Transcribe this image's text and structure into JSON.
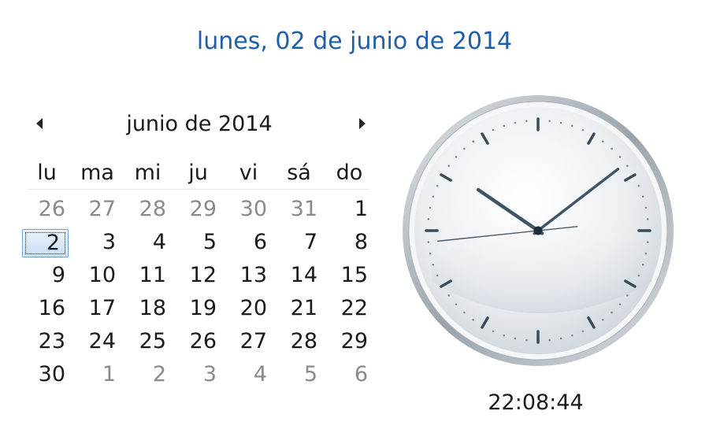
{
  "header": {
    "full_date": "lunes, 02 de junio de 2014"
  },
  "calendar": {
    "month_title": "junio de 2014",
    "prev_icon": "triangle-left-icon",
    "next_icon": "triangle-right-icon",
    "weekdays": [
      "lu",
      "ma",
      "mi",
      "ju",
      "vi",
      "sá",
      "do"
    ],
    "weeks": [
      [
        {
          "d": "26",
          "other": true
        },
        {
          "d": "27",
          "other": true
        },
        {
          "d": "28",
          "other": true
        },
        {
          "d": "29",
          "other": true
        },
        {
          "d": "30",
          "other": true
        },
        {
          "d": "31",
          "other": true
        },
        {
          "d": "1"
        }
      ],
      [
        {
          "d": "2",
          "today": true
        },
        {
          "d": "3"
        },
        {
          "d": "4"
        },
        {
          "d": "5"
        },
        {
          "d": "6"
        },
        {
          "d": "7"
        },
        {
          "d": "8"
        }
      ],
      [
        {
          "d": "9"
        },
        {
          "d": "10"
        },
        {
          "d": "11"
        },
        {
          "d": "12"
        },
        {
          "d": "13"
        },
        {
          "d": "14"
        },
        {
          "d": "15"
        }
      ],
      [
        {
          "d": "16"
        },
        {
          "d": "17"
        },
        {
          "d": "18"
        },
        {
          "d": "19"
        },
        {
          "d": "20"
        },
        {
          "d": "21"
        },
        {
          "d": "22"
        }
      ],
      [
        {
          "d": "23"
        },
        {
          "d": "24"
        },
        {
          "d": "25"
        },
        {
          "d": "26"
        },
        {
          "d": "27"
        },
        {
          "d": "28"
        },
        {
          "d": "29"
        }
      ],
      [
        {
          "d": "30"
        },
        {
          "d": "1",
          "other": true
        },
        {
          "d": "2",
          "other": true
        },
        {
          "d": "3",
          "other": true
        },
        {
          "d": "4",
          "other": true
        },
        {
          "d": "5",
          "other": true
        },
        {
          "d": "6",
          "other": true
        }
      ]
    ]
  },
  "clock": {
    "hours": 22,
    "minutes": 8,
    "seconds": 44,
    "time_text": "22:08:44"
  },
  "colors": {
    "link": "#1f5fa8",
    "text": "#1a1a1a",
    "muted": "#8a8a8a",
    "today_border": "#6a9fd6",
    "hand": "#3f5566"
  }
}
